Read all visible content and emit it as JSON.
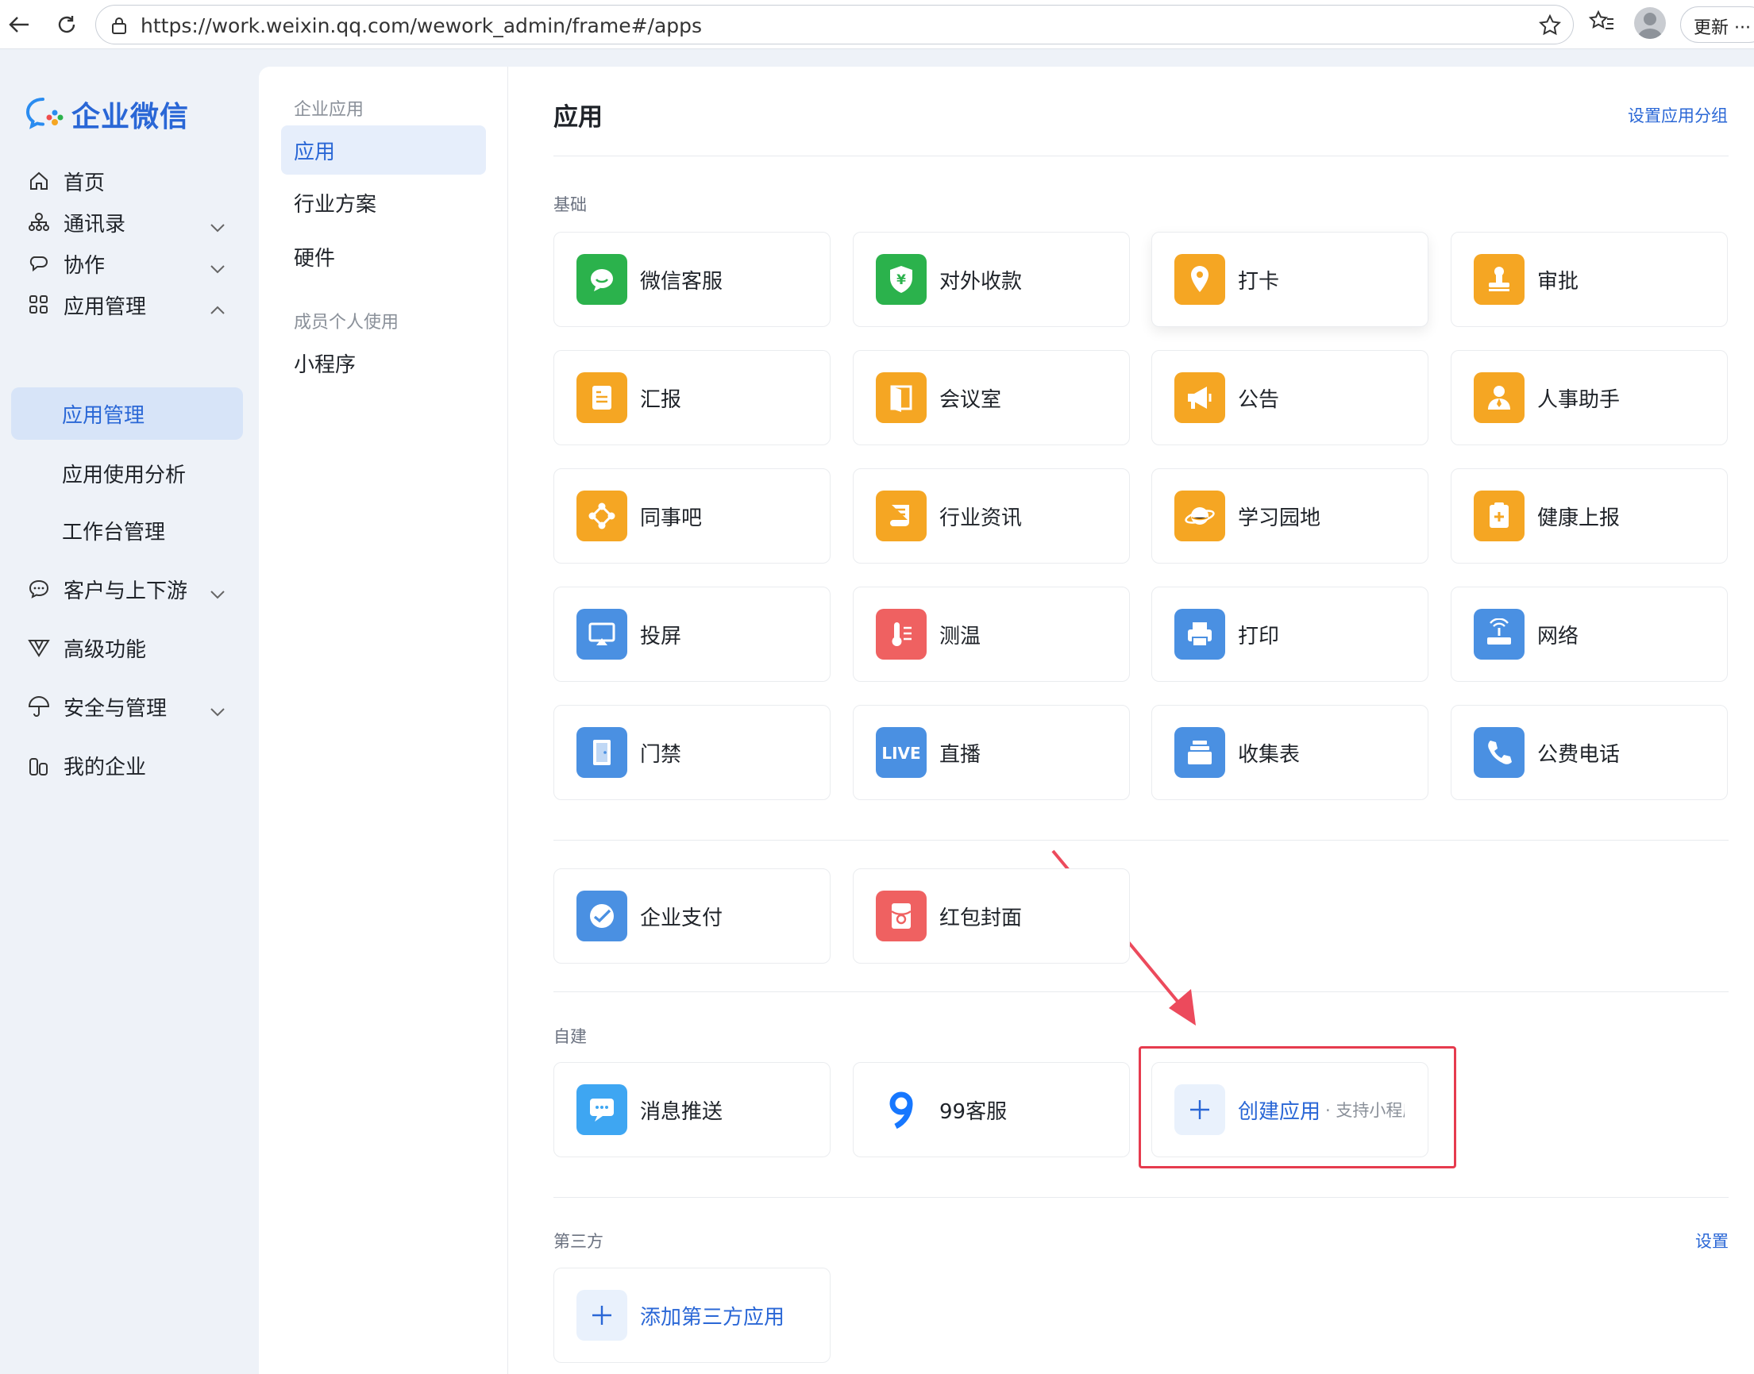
{
  "browser": {
    "url": "https://work.weixin.qq.com/wework_admin/frame#/apps",
    "update_label": "更新"
  },
  "logo": {
    "text": "企业微信"
  },
  "sidebar": {
    "items": [
      {
        "label": "首页",
        "icon": "home-icon"
      },
      {
        "label": "通讯录",
        "icon": "org-chart-icon"
      },
      {
        "label": "协作",
        "icon": "collaboration-icon"
      },
      {
        "label": "应用管理",
        "icon": "apps-grid-icon"
      },
      {
        "label": "客户与上下游",
        "icon": "chat-bubble-icon"
      },
      {
        "label": "高级功能",
        "icon": "advanced-icon"
      },
      {
        "label": "安全与管理",
        "icon": "umbrella-icon"
      },
      {
        "label": "我的企业",
        "icon": "building-icon"
      }
    ],
    "sub_items": [
      "应用管理",
      "应用使用分析",
      "工作台管理"
    ]
  },
  "subnav": {
    "group1": "企业应用",
    "items1": [
      "应用",
      "行业方案",
      "硬件"
    ],
    "group2": "成员个人使用",
    "items2": [
      "小程序"
    ]
  },
  "main": {
    "title": "应用",
    "group_link": "设置应用分组",
    "section_basic": "基础",
    "section_custom": "自建",
    "section_third": "第三方",
    "third_settings": "设置",
    "basic_apps": [
      {
        "label": "微信客服",
        "icon": "wechat-service-icon",
        "color": "#2bb24c"
      },
      {
        "label": "对外收款",
        "icon": "yuan-shield-icon",
        "color": "#2bb24c"
      },
      {
        "label": "打卡",
        "icon": "location-pin-icon",
        "color": "#f5a623"
      },
      {
        "label": "审批",
        "icon": "stamp-icon",
        "color": "#f5a623"
      },
      {
        "label": "汇报",
        "icon": "report-doc-icon",
        "color": "#f5a623"
      },
      {
        "label": "会议室",
        "icon": "door-icon",
        "color": "#f5a623"
      },
      {
        "label": "公告",
        "icon": "megaphone-icon",
        "color": "#f5a623"
      },
      {
        "label": "人事助手",
        "icon": "person-icon",
        "color": "#f5a623"
      },
      {
        "label": "同事吧",
        "icon": "network-icon",
        "color": "#f5a623"
      },
      {
        "label": "行业资讯",
        "icon": "news-scroll-icon",
        "color": "#f5a623"
      },
      {
        "label": "学习园地",
        "icon": "planet-icon",
        "color": "#f5a623"
      },
      {
        "label": "健康上报",
        "icon": "medical-report-icon",
        "color": "#f5a623"
      },
      {
        "label": "投屏",
        "icon": "screen-cast-icon",
        "color": "#4a90e2"
      },
      {
        "label": "测温",
        "icon": "thermometer-icon",
        "color": "#ef6161"
      },
      {
        "label": "打印",
        "icon": "printer-icon",
        "color": "#4a90e2"
      },
      {
        "label": "网络",
        "icon": "router-icon",
        "color": "#4a90e2"
      },
      {
        "label": "门禁",
        "icon": "access-door-icon",
        "color": "#4a90e2"
      },
      {
        "label": "直播",
        "icon": "live-icon",
        "color": "#4a90e2",
        "badge": "LIVE"
      },
      {
        "label": "收集表",
        "icon": "form-tray-icon",
        "color": "#4a90e2"
      },
      {
        "label": "公费电话",
        "icon": "phone-icon",
        "color": "#4a90e2"
      }
    ],
    "extra_apps": [
      {
        "label": "企业支付",
        "icon": "pay-check-icon",
        "color": "#4a90e2"
      },
      {
        "label": "红包封面",
        "icon": "red-envelope-icon",
        "color": "#ef6161"
      }
    ],
    "custom_apps": [
      {
        "label": "消息推送",
        "icon": "message-push-icon",
        "color": "#3ea6f2"
      },
      {
        "label": "99客服",
        "icon": "nine-logo-icon",
        "color": "#1677ff"
      }
    ],
    "create_app": {
      "label": "创建应用",
      "sub": "· 支持小程序"
    },
    "add_third": {
      "label": "添加第三方应用"
    }
  }
}
